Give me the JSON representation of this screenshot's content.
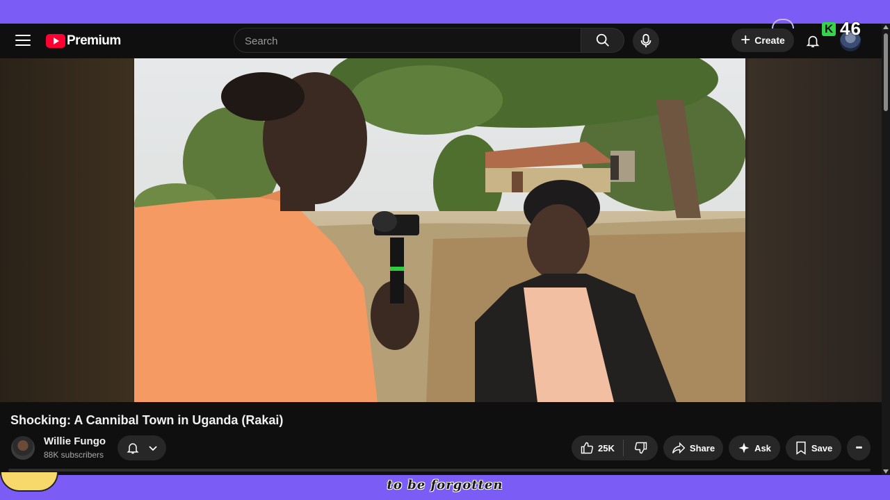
{
  "topbar": {
    "logo_text": "Premium",
    "search_placeholder": "Search",
    "create_label": "Create"
  },
  "overlay": {
    "badge_letter": "K",
    "badge_number": "46"
  },
  "video": {
    "title": "Shocking: A Cannibal Town in Uganda (Rakai)",
    "channel_name": "Willie Fungo",
    "channel_subscribers": "88K subscribers",
    "like_count": "25K",
    "share_label": "Share",
    "ask_label": "Ask",
    "save_label": "Save",
    "more_label": "•••"
  },
  "caption": {
    "text": "to be forgotten"
  },
  "colors": {
    "page_background": "#7b5cf5",
    "app_background": "#0f0f0f",
    "brand_red": "#ff0033",
    "badge_green": "#36d44c"
  },
  "icons": [
    "menu-icon",
    "youtube-logo-icon",
    "search-icon",
    "mic-icon",
    "plus-icon",
    "bell-icon",
    "like-icon",
    "dislike-icon",
    "share-icon",
    "sparkle-icon",
    "bookmark-icon",
    "more-icon",
    "chevron-down-icon"
  ]
}
